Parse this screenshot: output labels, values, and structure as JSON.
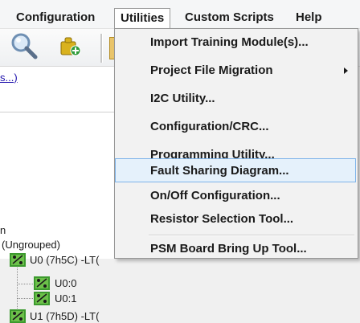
{
  "menubar": {
    "items": [
      {
        "label": "Configuration"
      },
      {
        "label": "Utilities"
      },
      {
        "label": "Custom Scripts"
      },
      {
        "label": "Help"
      }
    ]
  },
  "toolbar": {
    "icons": [
      "magnifier-icon",
      "plugin-icon",
      "partial-icon"
    ]
  },
  "panel": {
    "link_text": "s...)",
    "heading_fragment": "n",
    "tree": [
      {
        "label": "(Ungrouped)"
      },
      {
        "label": "U0 (7h5C) -LT("
      },
      {
        "label": "U0:0"
      },
      {
        "label": "U0:1"
      },
      {
        "label": "U1 (7h5D) -LT("
      }
    ]
  },
  "utilities_menu": {
    "items": [
      {
        "label": "Import Training Module(s)..."
      },
      {
        "label": "Project File Migration",
        "has_submenu": true
      },
      {
        "label": "I2C Utility..."
      },
      {
        "label": "Configuration/CRC..."
      },
      {
        "label": "Programming Utility..."
      },
      {
        "label": "Fault Sharing Diagram...",
        "highlighted": true
      },
      {
        "label": "On/Off Configuration..."
      },
      {
        "label": "Resistor Selection Tool..."
      },
      {
        "label": "PSM Board Bring Up Tool..."
      }
    ]
  },
  "colors": {
    "menu_highlight_bg": "#e5f1fb",
    "menu_highlight_border": "#7eb4ea",
    "tree_icon_green": "#3c9a2e"
  }
}
